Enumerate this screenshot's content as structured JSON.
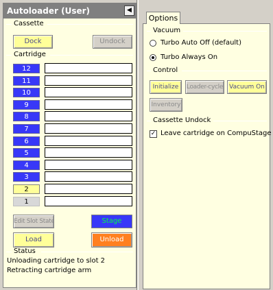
{
  "title": "Autoloader (User)",
  "collapse_glyph": "◀",
  "cassette": {
    "label": "Cassette",
    "dock": "Dock",
    "undock": "Undock"
  },
  "cartridge": {
    "label": "Cartridge",
    "slots": [
      {
        "n": "12",
        "state": "occupied"
      },
      {
        "n": "11",
        "state": "occupied"
      },
      {
        "n": "10",
        "state": "occupied"
      },
      {
        "n": "9",
        "state": "occupied"
      },
      {
        "n": "8",
        "state": "occupied"
      },
      {
        "n": "7",
        "state": "occupied"
      },
      {
        "n": "6",
        "state": "occupied"
      },
      {
        "n": "5",
        "state": "occupied"
      },
      {
        "n": "4",
        "state": "occupied"
      },
      {
        "n": "3",
        "state": "occupied"
      },
      {
        "n": "2",
        "state": "target"
      },
      {
        "n": "1",
        "state": "empty"
      }
    ],
    "edit_slot_state": "Edit Slot State",
    "stage": "Stage",
    "load": "Load",
    "unload": "Unload"
  },
  "status": {
    "label": "Status",
    "lines": [
      "Unloading cartridge to slot 2",
      "Retracting cartridge arm"
    ]
  },
  "options": {
    "tab_label": "Options",
    "vacuum": {
      "label": "Vacuum",
      "turbo_auto_off": "Turbo Auto Off (default)",
      "turbo_always_on": "Turbo Always On",
      "selected": "turbo_always_on"
    },
    "control": {
      "label": "Control",
      "initialize": "Initialize",
      "loader_cycle": "Loader-cycle",
      "vacuum_on": "Vacuum On",
      "inventory": "Inventory"
    },
    "cassette_undock": {
      "label": "Cassette Undock",
      "leave_cartridge": "Leave cartridge on CompuStage",
      "checked": true,
      "check_glyph": "✓"
    }
  },
  "colors": {
    "panel_bg": "#ffffe1",
    "slot_blue": "#3838f8",
    "stage_green": "#00ff40",
    "unload_orange": "#ff8020",
    "button_yellow": "#ffff99"
  }
}
